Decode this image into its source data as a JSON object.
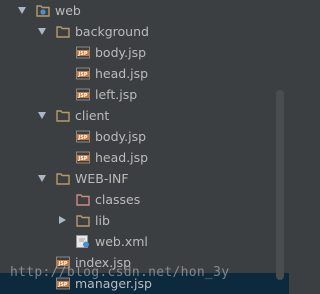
{
  "tree": {
    "items": [
      {
        "id": "web",
        "label": "web",
        "kind": "web-folder",
        "indent": 0,
        "expanded": true
      },
      {
        "id": "background",
        "label": "background",
        "kind": "folder",
        "indent": 1,
        "expanded": true
      },
      {
        "id": "bg-body",
        "label": "body.jsp",
        "kind": "jsp",
        "indent": 2
      },
      {
        "id": "bg-head",
        "label": "head.jsp",
        "kind": "jsp",
        "indent": 2
      },
      {
        "id": "bg-left",
        "label": "left.jsp",
        "kind": "jsp",
        "indent": 2
      },
      {
        "id": "client",
        "label": "client",
        "kind": "folder",
        "indent": 1,
        "expanded": true
      },
      {
        "id": "cl-body",
        "label": "body.jsp",
        "kind": "jsp",
        "indent": 2
      },
      {
        "id": "cl-head",
        "label": "head.jsp",
        "kind": "jsp",
        "indent": 2
      },
      {
        "id": "webinf",
        "label": "WEB-INF",
        "kind": "folder",
        "indent": 1,
        "expanded": true
      },
      {
        "id": "classes",
        "label": "classes",
        "kind": "classes-folder",
        "indent": 2
      },
      {
        "id": "lib",
        "label": "lib",
        "kind": "folder",
        "indent": 2,
        "expanded": false
      },
      {
        "id": "webxml",
        "label": "web.xml",
        "kind": "xml",
        "indent": 2
      },
      {
        "id": "index",
        "label": "index.jsp",
        "kind": "jsp",
        "indent": 1
      },
      {
        "id": "manager",
        "label": "manager.jsp",
        "kind": "jsp",
        "indent": 1,
        "selected": true
      }
    ]
  },
  "watermark": "http://blog.csdn.net/hon_3y",
  "colors": {
    "background": "#3c3f41",
    "text": "#bbbbbb",
    "selection": "#0d293e",
    "folder": "#b59a6a",
    "jsp_badge": "#c7783a",
    "classes_folder": "#d08a86"
  }
}
